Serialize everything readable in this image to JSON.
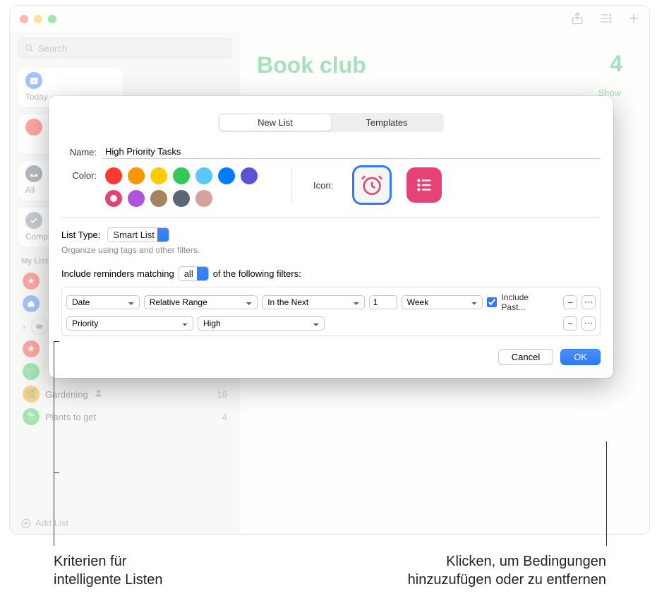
{
  "sidebar": {
    "search_placeholder": "Search",
    "tiles": {
      "today": "Today",
      "all": "All",
      "completed": "Completed"
    },
    "section_label": "My Lists",
    "visible_lists": [
      {
        "name": "Gardening",
        "count": "16"
      },
      {
        "name": "Plants to get",
        "count": "4"
      }
    ],
    "add_list_label": "Add List"
  },
  "content": {
    "title": "Book club",
    "count": "4",
    "show_label": "Show"
  },
  "dialog": {
    "tabs": {
      "new_list": "New List",
      "templates": "Templates"
    },
    "name_label": "Name:",
    "name_value": "High Priority Tasks",
    "color_label": "Color:",
    "colors": [
      "#fc3b30",
      "#fd9500",
      "#fdcc00",
      "#34c759",
      "#5ac8fa",
      "#007aff",
      "#5856d6",
      "#e54276",
      "#af52de",
      "#a2845e",
      "#5b6770",
      "#d4a29c"
    ],
    "icon_label": "Icon:",
    "list_type_label": "List Type:",
    "list_type_value": "Smart List",
    "list_type_hint": "Organize using tags and other filters.",
    "match_text_pre": "Include reminders matching",
    "match_mode": "all",
    "match_text_post": "of the following filters:",
    "filters": {
      "row1": {
        "attr": "Date",
        "rel": "Relative Range",
        "dir": "In the Next",
        "num": "1",
        "unit": "Week",
        "include_past": "Include Past..."
      },
      "row2": {
        "attr": "Priority",
        "val": "High"
      }
    },
    "cancel": "Cancel",
    "ok": "OK"
  },
  "callouts": {
    "left_l1": "Kriterien für",
    "left_l2": "intelligente Listen",
    "right_l1": "Klicken, um Bedingungen",
    "right_l2": "hinzuzufügen oder zu entfernen"
  }
}
